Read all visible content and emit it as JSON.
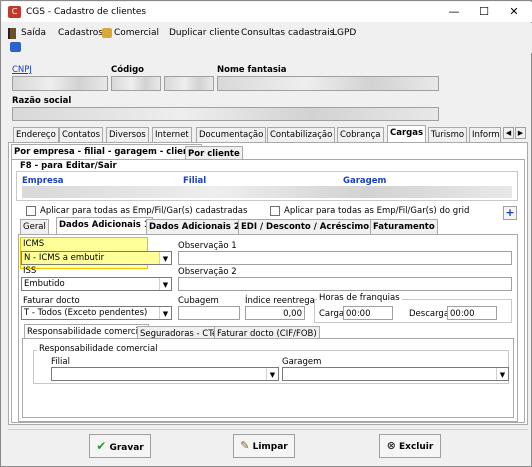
{
  "window": {
    "title": "CGS - Cadastro de clientes",
    "minimize": "—",
    "maximize": "☐",
    "close": "✕"
  },
  "menu": {
    "exit": "Saída",
    "items": [
      "Cadastros",
      "Comercial",
      "Duplicar cliente",
      "Consultas cadastrais",
      "LGPD"
    ]
  },
  "header": {
    "cnpj_label": "CNPJ",
    "codigo_label": "Código",
    "nome_fantasia_label": "Nome fantasia",
    "razao_social_label": "Razão social"
  },
  "tabs": [
    "Endereço",
    "Contatos",
    "Diversos",
    "Internet",
    "Documentação",
    "Contabilização",
    "Cobrança",
    "Cargas",
    "Turismo",
    "Inform"
  ],
  "subtabs": [
    "Por empresa - filial - garagem - cliente",
    "Por cliente"
  ],
  "f8_label": "F8 - para Editar/Sair",
  "columns": {
    "empresa": "Empresa",
    "filial": "Filial",
    "garagem": "Garagem"
  },
  "apply_all": "Aplicar para todas as Emp/Fil/Gar(s) cadastradas",
  "apply_grid": "Aplicar para todas as Emp/Fil/Gar(s) do grid",
  "plus": "+",
  "innertabs": [
    "Geral",
    "Dados Adicionais 1",
    "Dados Adicionais 2",
    "EDI / Desconto / Acréscimo",
    "Faturamento"
  ],
  "icms": {
    "label": "ICMS",
    "value": "N - ICMS a embutir"
  },
  "obs1": {
    "label": "Observação 1",
    "value": ""
  },
  "iss": {
    "label": "ISS",
    "value": "Embutido"
  },
  "obs2": {
    "label": "Observação 2",
    "value": ""
  },
  "faturar": {
    "label": "Faturar docto",
    "value": "T - Todos (Exceto pendentes)"
  },
  "cubagem": {
    "label": "Cubagem",
    "value": ""
  },
  "indice": {
    "label": "Índice reentrega",
    "value": "0,00"
  },
  "horas": {
    "label": "Horas de franquias",
    "carga_label": "Carga",
    "carga_value": "00:00",
    "descarga_label": "Descarga",
    "descarga_value": "00:00"
  },
  "bottomtabs": [
    "Responsabilidade comercial",
    "Seguradoras - CTe",
    "Faturar docto (CIF/FOB)"
  ],
  "resp": {
    "group_label": "Responsabilidade comercial",
    "filial_label": "Filial",
    "garagem_label": "Garagem"
  },
  "buttons": {
    "gravar": "Gravar",
    "limpar": "Limpar",
    "excluir": "Excluir"
  },
  "colors": {
    "icms_highlight": "#ffff99",
    "gravar_check": "#2a9a2a",
    "excluir_icon": "#333333"
  }
}
